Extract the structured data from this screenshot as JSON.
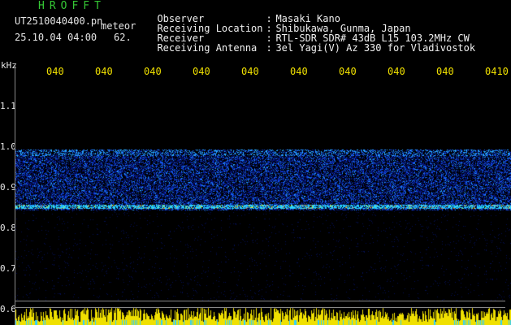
{
  "header": {
    "app_title": "HROFFT",
    "file_name": "UT2510040400.pn",
    "meteor_label": "meteor",
    "date_time": "25.10.04 04:00",
    "count": "62."
  },
  "info": [
    {
      "label": "Observer",
      "sep": ":",
      "value": "Masaki Kano"
    },
    {
      "label": "Receiving Location",
      "sep": ":",
      "value": "Shibukawa, Gunma, Japan"
    },
    {
      "label": "Receiver",
      "sep": ":",
      "value": "RTL-SDR SDR# 43dB L15 103.2MHz CW"
    },
    {
      "label": "Receiving Antenna",
      "sep": ":",
      "value": "3el Yagi(V) Az 330 for Vladivostok"
    }
  ],
  "axis": {
    "unit": "kHz",
    "y_ticks": [
      "1.1",
      "1.0",
      "0.9",
      "0.8",
      "0.7",
      "0.6"
    ],
    "time_labels": [
      "040",
      "040",
      "040",
      "040",
      "040",
      "040",
      "040",
      "040",
      "040",
      "0410"
    ]
  },
  "colors": {
    "background": "#000000",
    "title": "#35c835",
    "time_labels": "#f0e000",
    "noise_low": "#0a1a80",
    "noise_mid": "#1e50ff",
    "signal_line": "#30d0ff",
    "bottom_bar": "#f0e000"
  }
}
